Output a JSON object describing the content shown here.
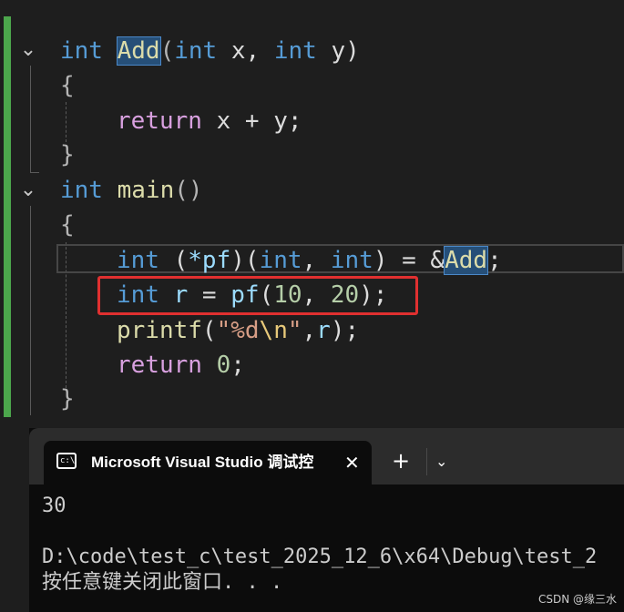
{
  "editor": {
    "lines": [
      {
        "id": "l1",
        "tokens": [
          [
            "int",
            "kw"
          ],
          [
            " ",
            "plain"
          ],
          [
            "Add",
            "fn"
          ],
          [
            "(",
            "punct"
          ],
          [
            "int",
            "kw"
          ],
          [
            " x, ",
            "plain"
          ],
          [
            "int",
            "kw"
          ],
          [
            " y)",
            "plain"
          ]
        ]
      },
      {
        "id": "l2",
        "tokens": [
          [
            "{",
            "punct"
          ]
        ]
      },
      {
        "id": "l3",
        "tokens": [
          [
            "return",
            "kw2"
          ],
          [
            " x + y;",
            "plain"
          ]
        ]
      },
      {
        "id": "l4",
        "tokens": [
          [
            "}",
            "punct"
          ]
        ]
      },
      {
        "id": "l5",
        "tokens": [
          [
            "int",
            "kw"
          ],
          [
            " ",
            "plain"
          ],
          [
            "main",
            "fn"
          ],
          [
            "()",
            "punct"
          ]
        ]
      },
      {
        "id": "l6",
        "tokens": [
          [
            "{",
            "punct"
          ]
        ]
      },
      {
        "id": "l7",
        "tokens": [
          [
            "int",
            "kw"
          ],
          [
            " (",
            "plain"
          ],
          [
            "*pf",
            "var"
          ],
          [
            ")(",
            "plain"
          ],
          [
            "int",
            "kw"
          ],
          [
            ", ",
            "plain"
          ],
          [
            "int",
            "kw"
          ],
          [
            ") = &",
            "plain"
          ],
          [
            "Add",
            "fn"
          ],
          [
            ";",
            "plain"
          ]
        ]
      },
      {
        "id": "l8",
        "tokens": [
          [
            "int",
            "kw"
          ],
          [
            " ",
            "plain"
          ],
          [
            "r",
            "var"
          ],
          [
            " = ",
            "plain"
          ],
          [
            "pf",
            "var"
          ],
          [
            "(",
            "plain"
          ],
          [
            "10",
            "num"
          ],
          [
            ", ",
            "plain"
          ],
          [
            "20",
            "num"
          ],
          [
            ");",
            "plain"
          ]
        ]
      },
      {
        "id": "l9",
        "tokens": [
          [
            "printf",
            "fn"
          ],
          [
            "(",
            "plain"
          ],
          [
            "\"%d",
            "str"
          ],
          [
            "\\n",
            "esc"
          ],
          [
            "\"",
            "str"
          ],
          [
            ",",
            "plain"
          ],
          [
            "r",
            "var"
          ],
          [
            ");",
            "plain"
          ]
        ]
      },
      {
        "id": "l10",
        "tokens": [
          [
            "return",
            "kw2"
          ],
          [
            " ",
            "plain"
          ],
          [
            "0",
            "num"
          ],
          [
            ";",
            "plain"
          ]
        ]
      },
      {
        "id": "l11",
        "tokens": [
          [
            "}",
            "punct"
          ]
        ]
      }
    ]
  },
  "terminal": {
    "tab_title": "Microsoft Visual Studio 调试控",
    "icon_text": "c:\\",
    "close_glyph": "✕",
    "new_tab_glyph": "+",
    "dropdown_glyph": "⌄",
    "output_line1": "30",
    "output_line2": "D:\\code\\test_c\\test_2025_12_6\\x64\\Debug\\test_2",
    "output_line3": "按任意键关闭此窗口. . ."
  },
  "watermark": "CSDN @缘三水",
  "colors": {
    "keyword": "#569cd6",
    "control": "#d8a0df",
    "function": "#dcdcaa",
    "variable": "#9cdcfe",
    "number": "#b5cea8",
    "string": "#d69d85",
    "highlight_box": "#e03030"
  }
}
